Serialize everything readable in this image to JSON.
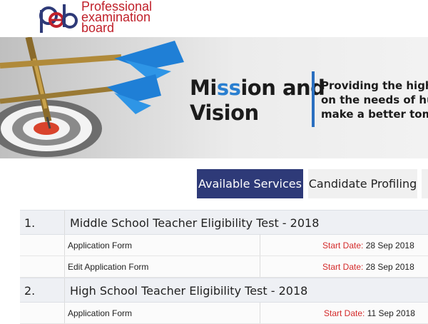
{
  "header": {
    "brand_line1": "Professional",
    "brand_line2": "examination",
    "brand_line3": "board",
    "brand_color": "#c0202a"
  },
  "banner": {
    "heading_part1": "Mi",
    "heading_part2": "ss",
    "heading_part3": "ion and",
    "heading_line2": "Vision",
    "tagline_line1": "Providing the highest",
    "tagline_line2": "on the needs of huma",
    "tagline_line3": "make a better tomorr",
    "accent_color": "#2a7fd0"
  },
  "tabs": [
    {
      "label": "Available Services",
      "active": true
    },
    {
      "label": "Candidate Profiling",
      "active": false
    }
  ],
  "services": [
    {
      "number": "1.",
      "title": "Middle School Teacher Eligibility Test - 2018",
      "forms": [
        {
          "label": "Application Form",
          "date_label": "Start Date:",
          "date": " 28 Sep 2018"
        },
        {
          "label": "Edit Application Form",
          "date_label": "Start Date:",
          "date": " 28 Sep 2018"
        }
      ]
    },
    {
      "number": "2.",
      "title": "High School Teacher Eligibility Test - 2018",
      "forms": [
        {
          "label": "Application Form",
          "date_label": "Start Date:",
          "date": " 11 Sep 2018"
        }
      ]
    }
  ],
  "colors": {
    "tab_active_bg": "#2e3a78",
    "date_label": "#d42a2a"
  }
}
